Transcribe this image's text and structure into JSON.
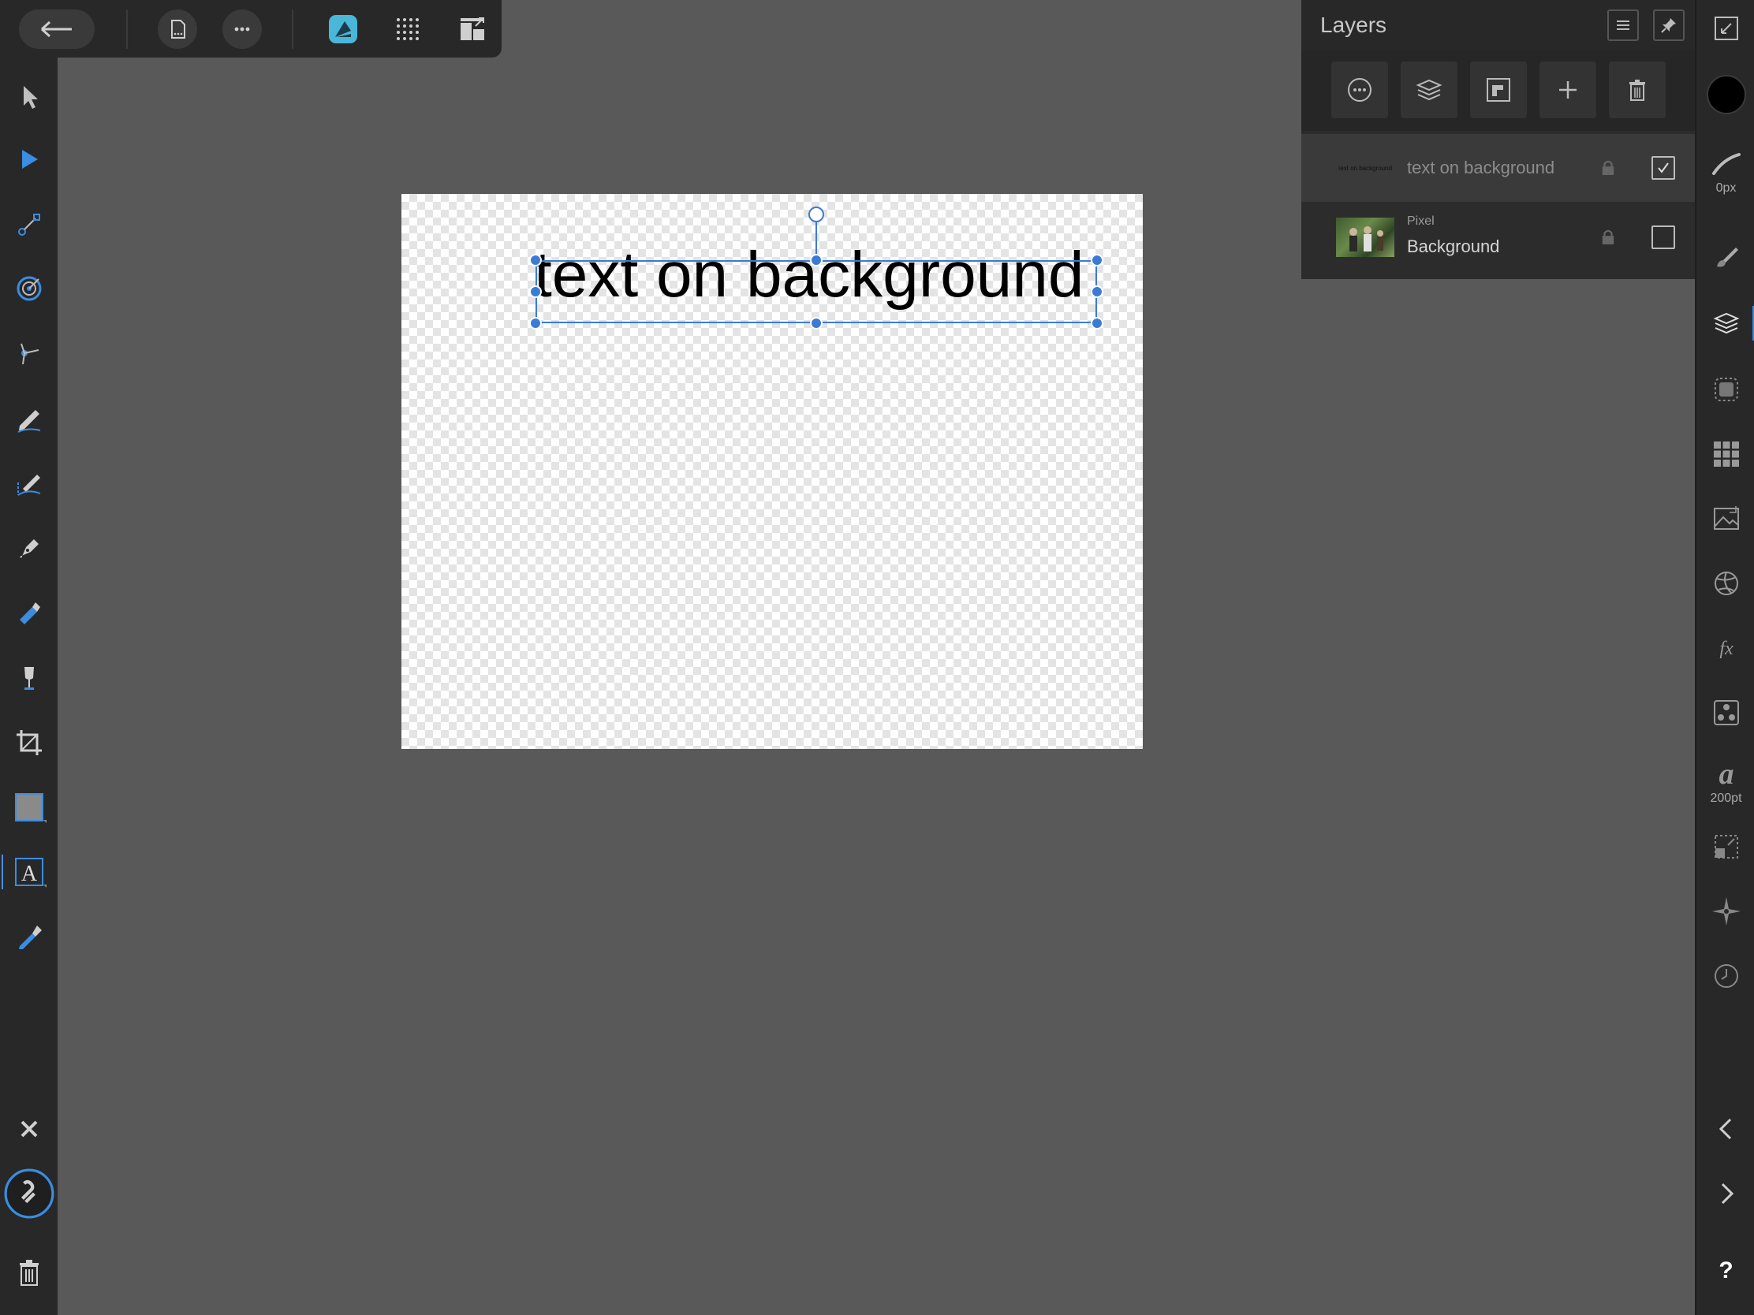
{
  "top_toolbar": {
    "back_icon": "arrow-left-icon",
    "buttons": [
      "document-icon",
      "more-icon",
      "persona-icon",
      "grid-icon",
      "arrange-icon"
    ],
    "accent_color": "#4ab6d8"
  },
  "layers_panel": {
    "title": "Layers",
    "actions": [
      "blend-options-icon",
      "layer-stack-icon",
      "mask-icon",
      "add-layer-icon",
      "delete-layer-icon"
    ],
    "layers": [
      {
        "type": "",
        "name": "text on background",
        "thumbnail_text": "text on background",
        "visible": true,
        "selected": true
      },
      {
        "type": "Pixel",
        "name": "Background",
        "thumbnail_text": "",
        "visible": false,
        "selected": false
      }
    ]
  },
  "right_bar": {
    "stroke_width": "0px",
    "font_size": "200pt",
    "help": "?"
  },
  "canvas": {
    "text": "text on background",
    "selection_color": "#3a7bd5"
  }
}
